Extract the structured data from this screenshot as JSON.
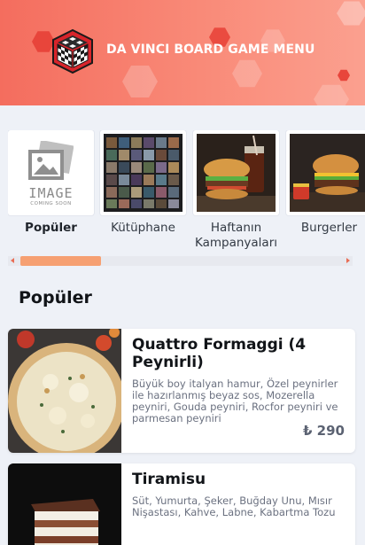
{
  "header": {
    "title": "DA VINCI BOARD GAME MENU",
    "gradient_start": "#f46d5e",
    "gradient_end": "#fba08f"
  },
  "categories": [
    {
      "label": "Popüler",
      "active": true,
      "image": "image-coming-soon",
      "placeholder_line1": "IMAGE",
      "placeholder_line2": "COMING SOON"
    },
    {
      "label": "Kütüphane",
      "active": false,
      "image": "board-game-shelf"
    },
    {
      "label": "Haftanın Kampanyaları",
      "active": false,
      "image": "burger-and-cola"
    },
    {
      "label": "Burgerler",
      "active": false,
      "image": "burger"
    }
  ],
  "scrollbar": {
    "position_fraction": 0.0,
    "accent": "#f6a072"
  },
  "section_title": "Popüler",
  "products": [
    {
      "name": "Quattro Formaggi (4 Peynirli)",
      "description": "Büyük boy italyan hamur, Özel peynirler ile hazırlanmış beyaz sos, Mozerella peyniri, Gouda peyniri, Rocfor peyniri ve parmesan peyniri",
      "price": "₺ 290",
      "image": "pizza"
    },
    {
      "name": "Tiramisu",
      "description": "Süt, Yumurta, Şeker, Buğday Unu, Mısır Nişastası, Kahve, Labne, Kabartma Tozu",
      "price": "",
      "image": "tiramisu"
    }
  ]
}
